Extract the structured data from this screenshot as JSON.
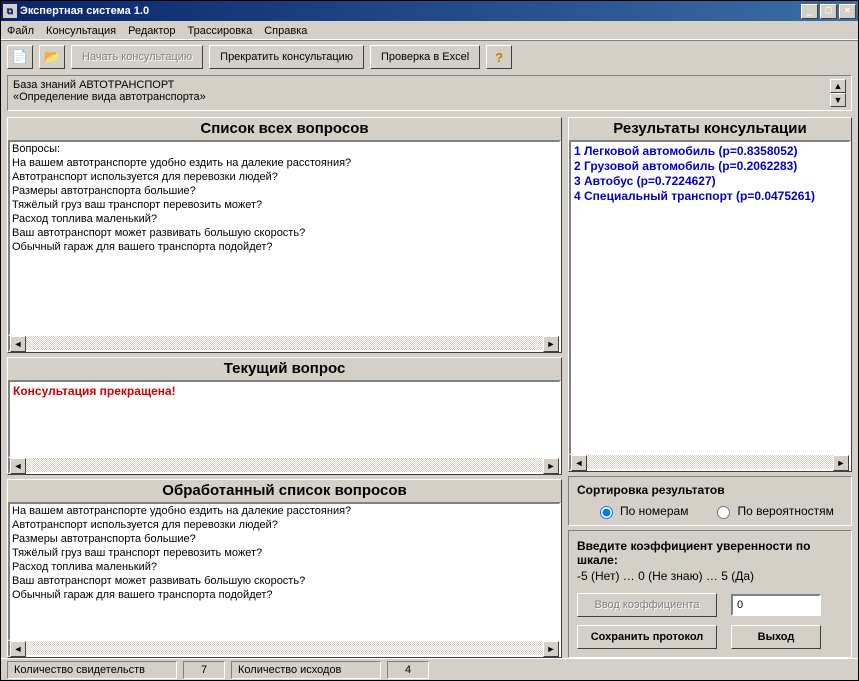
{
  "window": {
    "title": "Экспертная система 1.0",
    "minimize": "_",
    "maximize": "□",
    "close": "×"
  },
  "menu": {
    "file": "Файл",
    "consult": "Консультация",
    "editor": "Редактор",
    "trace": "Трассировка",
    "help": "Справка"
  },
  "toolbar": {
    "start_label": "Начать консультацию",
    "stop_label": "Прекратить консультацию",
    "check_label": "Проверка в Excel",
    "help_symbol": "?"
  },
  "info": {
    "line1": "База знаний АВТОТРАНСПОРТ",
    "line2": "«Определение вида автотранспорта»"
  },
  "questions": {
    "title": "Список всех вопросов",
    "header": "Вопросы:",
    "items": [
      "На вашем автотранспорте удобно ездить на далекие расстояния?",
      "Автотранспорт используется для перевозки людей?",
      "Размеры автотранспорта большие?",
      "Тяжёлый груз ваш транспорт перевозить может?",
      "Расход топлива маленький?",
      "Ваш автотранспорт может развивать большую скорость?",
      "Обычный гараж для вашего транспорта подойдет?"
    ]
  },
  "current": {
    "title": "Текущий вопрос",
    "message": "Консультация прекращена!"
  },
  "processed": {
    "title": "Обработанный список вопросов",
    "items": [
      "На вашем автотранспорте удобно ездить на далекие расстояния?",
      "Автотранспорт используется для перевозки людей?",
      "Размеры автотранспорта большие?",
      "Тяжёлый груз ваш транспорт перевозить может?",
      "Расход топлива маленький?",
      "Ваш автотранспорт может развивать большую скорость?",
      "Обычный гараж для вашего транспорта подойдет?"
    ]
  },
  "results": {
    "title": "Результаты консультации",
    "items": [
      "1 Легковой автомобиль (p=0.8358052)",
      "2 Грузовой автомобиль (p=0.2062283)",
      "3 Автобус (p=0.7224627)",
      "4 Специальный транспорт (p=0.0475261)"
    ]
  },
  "sort": {
    "title": "Сортировка результатов",
    "by_number": "По номерам",
    "by_prob": "По вероятностям"
  },
  "coef": {
    "prompt": "Введите коэффициент уверенности по шкале:",
    "scale": "-5 (Нет) … 0 (Не знаю) … 5 (Да)",
    "enter_btn": "Ввод коэффициента",
    "value": "0",
    "save_btn": "Сохранить протокол",
    "exit_btn": "Выход"
  },
  "status": {
    "evidence_label": "Количество свидетельств",
    "evidence_value": "7",
    "outcome_label": "Количество исходов",
    "outcome_value": "4"
  }
}
